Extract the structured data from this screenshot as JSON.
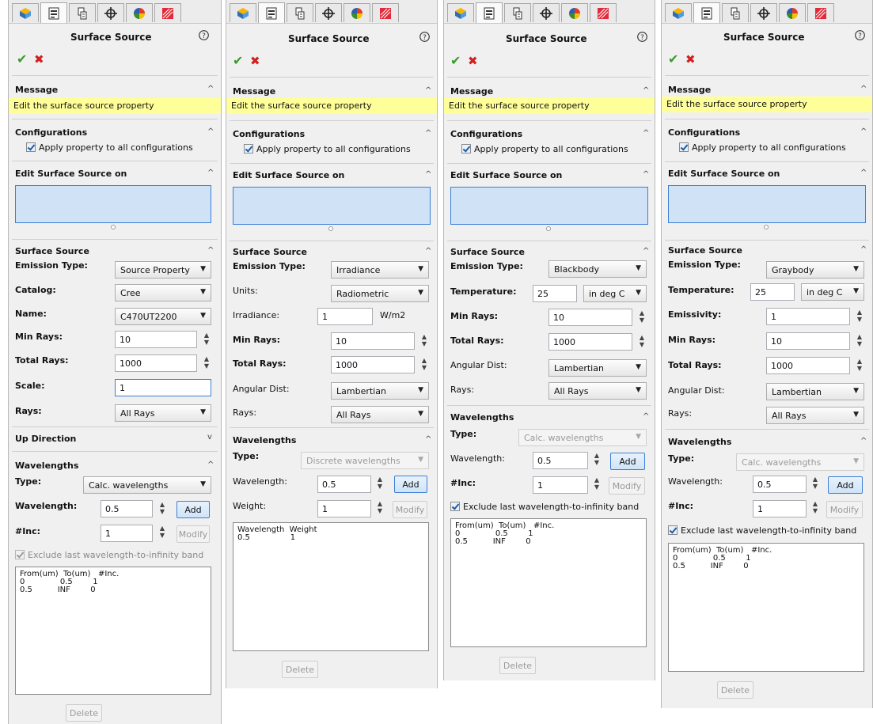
{
  "common": {
    "title": "Surface Source",
    "help_glyph": "?",
    "ok_glyph": "✔",
    "cancel_glyph": "✖",
    "message_header": "Message",
    "message_text": "Edit the surface source property",
    "config_header": "Configurations",
    "config_checkbox_label": "Apply property to all configurations",
    "edit_on_header": "Edit Surface Source on",
    "surface_source_header": "Surface Source",
    "emission_type_label": "Emission Type:",
    "wavelengths_header": "Wavelengths",
    "type_label": "Type:",
    "wavelength_label": "Wavelength:",
    "inc_label": "#Inc:",
    "min_rays_label": "Min Rays:",
    "total_rays_label": "Total Rays:",
    "rays_label": "Rays:",
    "angular_dist_label": "Angular Dist:",
    "temperature_label": "Temperature:",
    "add_label": "Add",
    "modify_label": "Modify",
    "delete_label": "Delete",
    "exclude_label": "Exclude last wavelength-to-infinity band",
    "chevron_up": "^",
    "chevron_down": "v",
    "tab_icons": [
      "feature-manager-icon",
      "property-manager-icon",
      "configuration-manager-icon",
      "dimxpert-icon",
      "display-manager-icon",
      "optics-manager-icon"
    ]
  },
  "panels": [
    {
      "emission_type": "Source Property",
      "catalog_label": "Catalog:",
      "catalog": "Cree",
      "name_label": "Name:",
      "name": "C470UT2200",
      "min_rays": "10",
      "total_rays": "1000",
      "scale_label": "Scale:",
      "scale": "1",
      "rays": "All Rays",
      "up_direction_header": "Up Direction",
      "wavelength_type": "Calc. wavelengths",
      "wavelength": "0.5",
      "inc": "1",
      "table": [
        "From(um)  To(um)   #Inc.",
        "0              0.5        1",
        "0.5          INF        0"
      ]
    },
    {
      "emission_type": "Irradiance",
      "units_label": "Units:",
      "units": "Radiometric",
      "irradiance_label": "Irradiance:",
      "irradiance": "1",
      "irradiance_unit": "W/m2",
      "min_rays": "10",
      "total_rays": "1000",
      "angular_dist": "Lambertian",
      "rays": "All Rays",
      "wavelength_type": "Discrete wavelengths",
      "wavelength": "0.5",
      "weight_label": "Weight:",
      "weight": "1",
      "table": [
        "Wavelength  Weight",
        "0.5                1"
      ]
    },
    {
      "emission_type": "Blackbody",
      "temperature": "25",
      "temp_unit": "in deg C",
      "min_rays": "10",
      "total_rays": "1000",
      "angular_dist": "Lambertian",
      "rays": "All Rays",
      "wavelength_type": "Calc. wavelengths",
      "wavelength": "0.5",
      "inc": "1",
      "table": [
        "From(um)  To(um)   #Inc.",
        "0              0.5        1",
        "0.5          INF        0"
      ]
    },
    {
      "emission_type": "Graybody",
      "temperature": "25",
      "temp_unit": "in deg C",
      "emissivity_label": "Emissivity:",
      "emissivity": "1",
      "min_rays": "10",
      "total_rays": "1000",
      "angular_dist": "Lambertian",
      "rays": "All Rays",
      "wavelength_type": "Calc. wavelengths",
      "wavelength": "0.5",
      "inc": "1",
      "table": [
        "From(um)  To(um)   #Inc.",
        "0              0.5        1",
        "0.5          INF        0"
      ]
    }
  ]
}
